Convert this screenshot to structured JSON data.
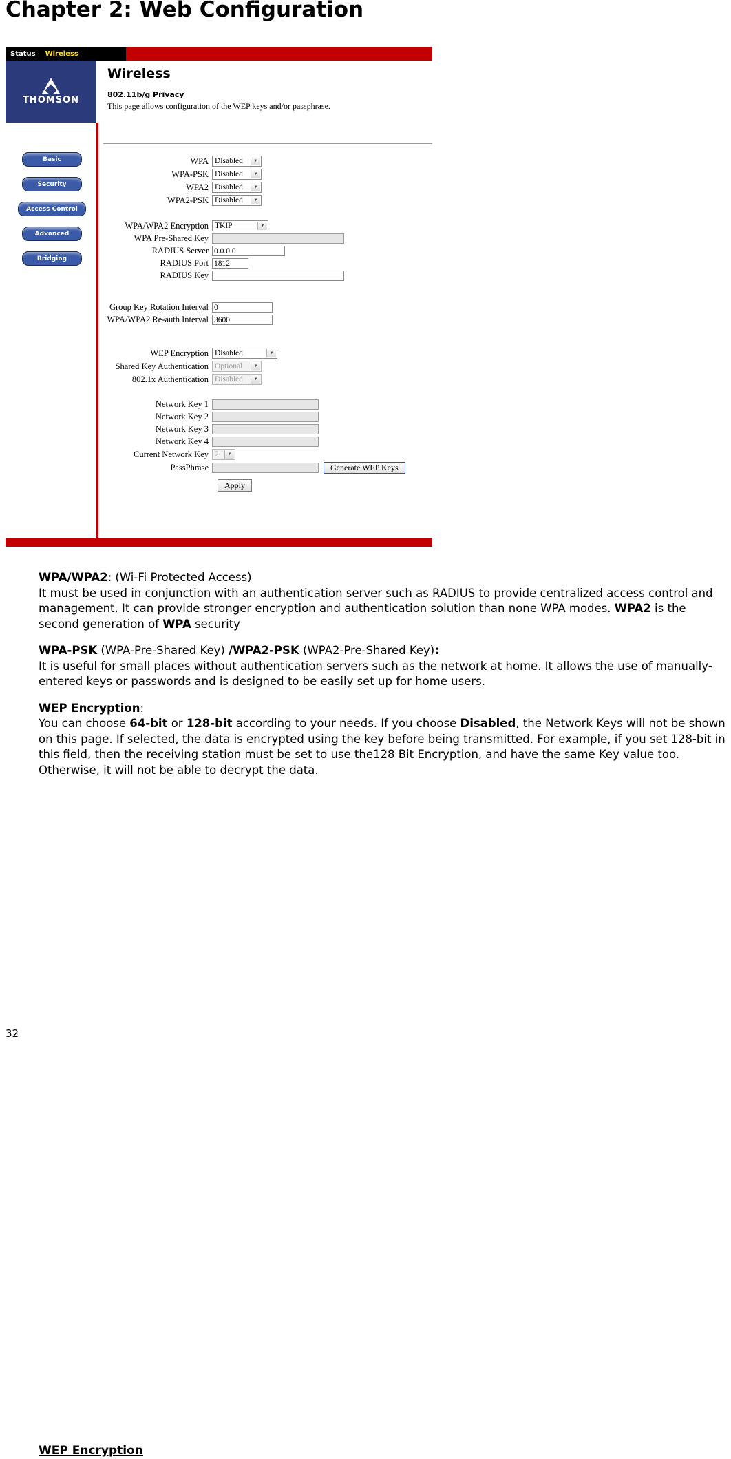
{
  "page": {
    "chapter_title": "Chapter 2: Web Configuration",
    "page_number": "32"
  },
  "router_ui": {
    "tabs": [
      {
        "label": "Status",
        "active": false
      },
      {
        "label": "Wireless",
        "active": true
      }
    ],
    "brand": "THOMSON",
    "nav_buttons": [
      "Basic",
      "Security",
      "Access Control",
      "Advanced",
      "Bridging"
    ],
    "heading": "Wireless",
    "subheading": "802.11b/g Privacy",
    "description": "This page allows configuration of the WEP keys and/or passphrase.",
    "fields": {
      "wpa": {
        "label": "WPA",
        "value": "Disabled"
      },
      "wpa_psk": {
        "label": "WPA-PSK",
        "value": "Disabled"
      },
      "wpa2": {
        "label": "WPA2",
        "value": "Disabled"
      },
      "wpa2_psk": {
        "label": "WPA2-PSK",
        "value": "Disabled"
      },
      "wpa_encryption": {
        "label": "WPA/WPA2 Encryption",
        "value": "TKIP"
      },
      "wpa_preshared_key": {
        "label": "WPA Pre-Shared Key",
        "value": ""
      },
      "radius_server": {
        "label": "RADIUS Server",
        "value": "0.0.0.0"
      },
      "radius_port": {
        "label": "RADIUS Port",
        "value": "1812"
      },
      "radius_key": {
        "label": "RADIUS Key",
        "value": ""
      },
      "group_key_rotation": {
        "label": "Group Key Rotation Interval",
        "value": "0"
      },
      "reauth_interval": {
        "label": "WPA/WPA2 Re-auth Interval",
        "value": "3600"
      },
      "wep_encryption": {
        "label": "WEP Encryption",
        "value": "Disabled"
      },
      "shared_key_auth": {
        "label": "Shared Key Authentication",
        "value": "Optional"
      },
      "dot1x_auth": {
        "label": "802.1x Authentication",
        "value": "Disabled"
      },
      "network_key_1": {
        "label": "Network Key 1",
        "value": ""
      },
      "network_key_2": {
        "label": "Network Key 2",
        "value": ""
      },
      "network_key_3": {
        "label": "Network Key 3",
        "value": ""
      },
      "network_key_4": {
        "label": "Network Key 4",
        "value": ""
      },
      "current_network_key": {
        "label": "Current Network Key",
        "value": "2"
      },
      "passphrase": {
        "label": "PassPhrase",
        "value": ""
      }
    },
    "buttons": {
      "generate_wep_keys": "Generate WEP Keys",
      "apply": "Apply"
    }
  },
  "content": {
    "para1": {
      "term": "WPA/WPA2",
      "term_rest": ": (Wi-Fi Protected Access)",
      "line_a": "It must be used in conjunction with an authentication server such as RADIUS to provide centralized access control and management. It can provide stronger encryption and authentication solution than none WPA modes. ",
      "bold_b": "WPA2",
      "line_c": " is the second generation of ",
      "bold_d": "WPA",
      "line_e": " security"
    },
    "para2": {
      "term": "WPA-PSK",
      "term_rest": " (WPA-Pre-Shared Key) ",
      "term2": "/WPA2-PSK",
      "term2_rest": " (WPA2-Pre-Shared Key)",
      "colon": ":",
      "body": "It is useful for small places without authentication servers such as the network at home. It allows the use of manually-entered keys or passwords and is designed to be easily set up for home users."
    },
    "para3": {
      "term": "WEP Encryption",
      "term_rest": ":",
      "line_a": "You can choose ",
      "bold_b": "64-bit",
      "line_c": " or ",
      "bold_d": "128-bit",
      "line_e": " according to your needs. If you choose ",
      "bold_f": "Disabled",
      "line_g": ", the Network Keys will not be shown on this page. If selected, the data is encrypted using the key before being transmitted. For example, if you set 128-bit in this field, then the receiving station must be set to use the128 Bit Encryption, and have the same Key value too. Otherwise, it will not be able to decrypt the data."
    },
    "section_heading": "WEP Encryption"
  }
}
